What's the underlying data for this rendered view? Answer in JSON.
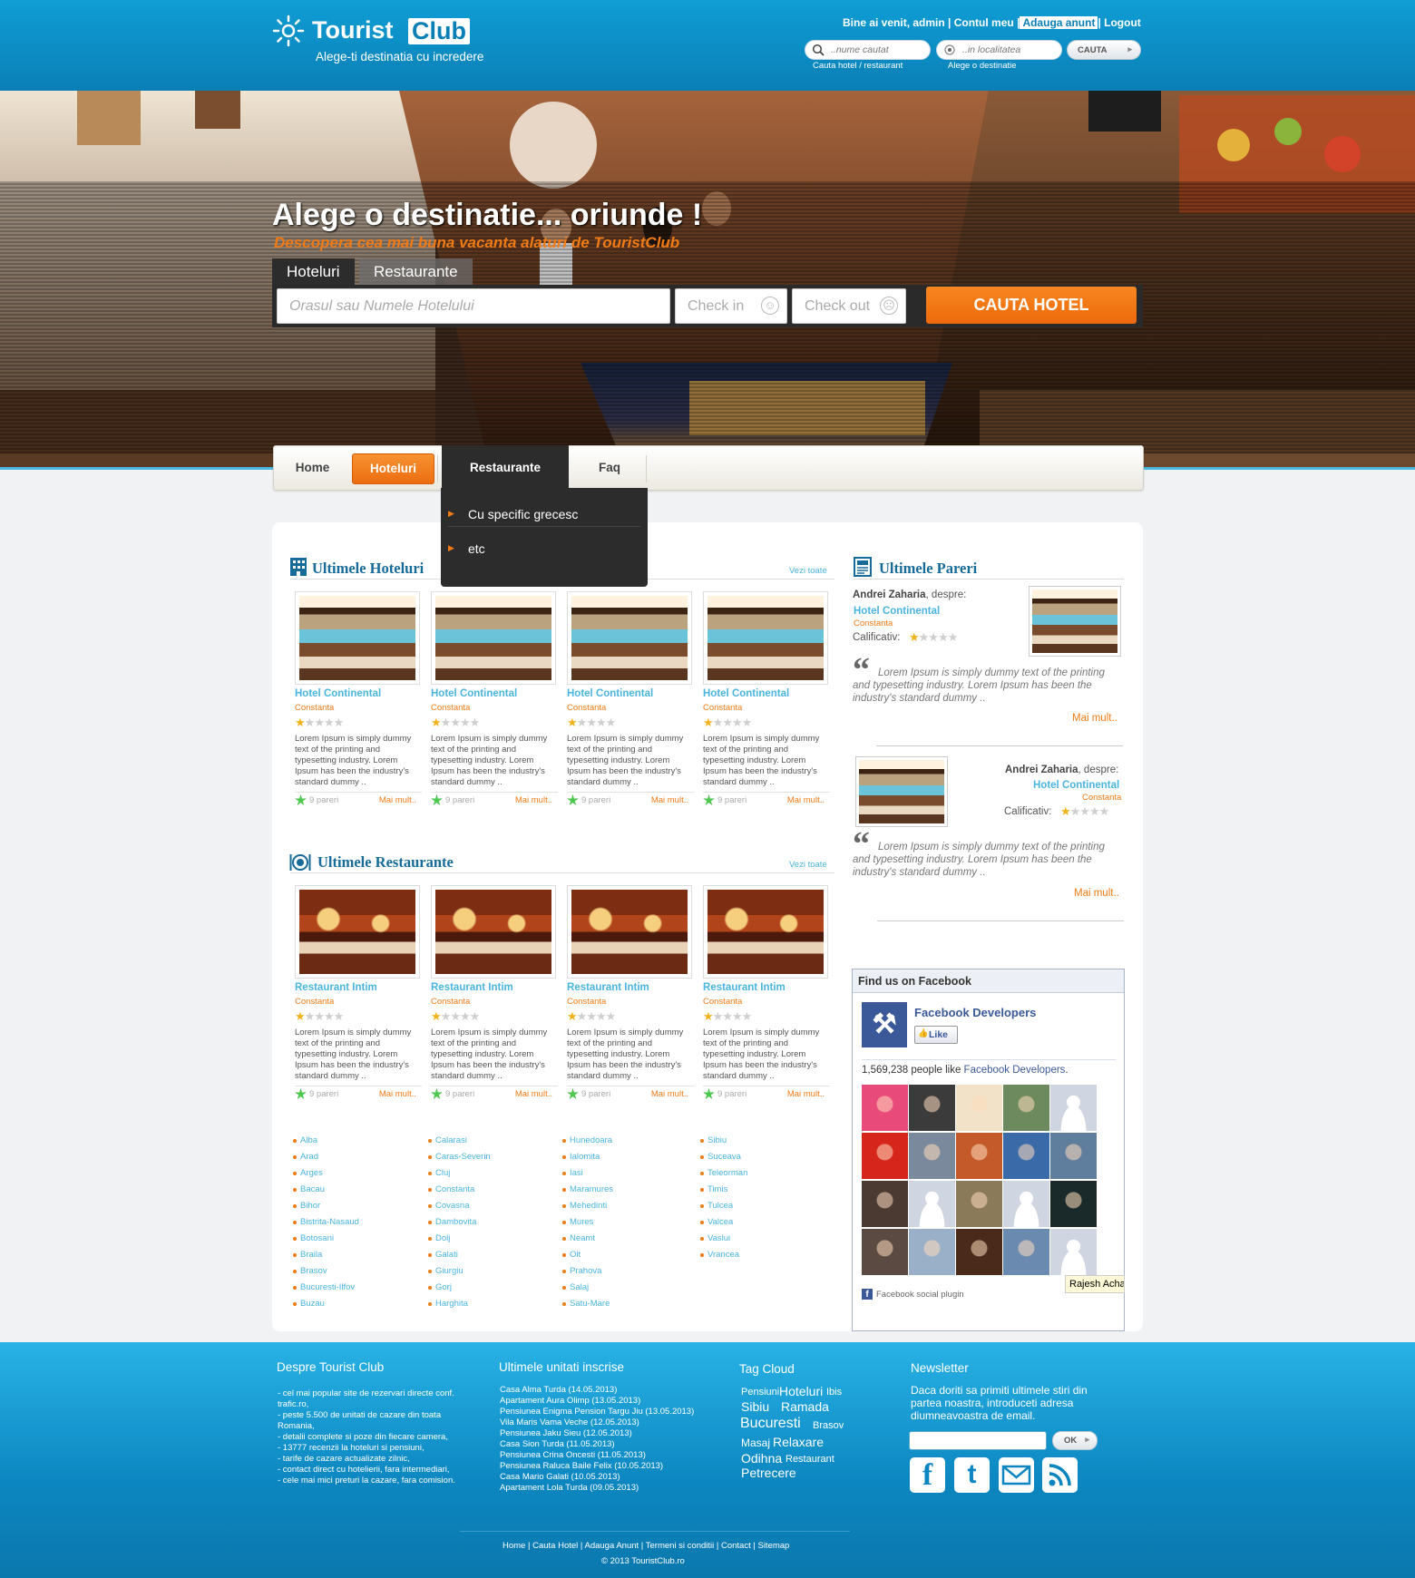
{
  "header": {
    "logo_word1": "Tourist",
    "logo_word2": "Club",
    "tagline": "Alege-ti destinatia cu incredere",
    "welcome": "Bine ai venit, admin",
    "my_account": "Contul meu",
    "add_listing": "Adauga anunt",
    "logout": "Logout",
    "name_placeholder": "..nume cautat",
    "location_placeholder": "..in localitatea",
    "search_button": "CAUTA",
    "name_caption": "Cauta hotel / restaurant",
    "location_caption": "Alege o destinatie"
  },
  "hero": {
    "title": "Alege o destinatie... oriunde !",
    "subtitle": "Descopera cea mai buna vacanta alaturi de TouristClub",
    "tabs": [
      "Hoteluri",
      "Restaurante"
    ],
    "search_placeholder": "Orasul sau Numele Hotelului",
    "checkin": "Check in",
    "checkout": "Check out",
    "search_button": "CAUTA HOTEL"
  },
  "nav": {
    "items": [
      "Home",
      "Hoteluri",
      "Restaurante",
      "Faq"
    ],
    "dropdown": [
      "Cu specific grecesc",
      "etc"
    ]
  },
  "hotels": {
    "title": "Ultimele Hoteluri",
    "see_all": "Vezi toate",
    "cards": [
      {
        "name": "Hotel Continental",
        "city": "Constanta",
        "rating": 1,
        "desc": "Lorem Ipsum is simply dummy text of the printing and typesetting industry. Lorem Ipsum has been the industry's standard dummy ..",
        "reviews": "9 pareri",
        "more": "Mai mult.."
      },
      {
        "name": "Hotel Continental",
        "city": "Constanta",
        "rating": 1,
        "desc": "Lorem Ipsum is simply dummy text of the printing and typesetting industry. Lorem Ipsum has been the industry's standard dummy ..",
        "reviews": "9 pareri",
        "more": "Mai mult.."
      },
      {
        "name": "Hotel Continental",
        "city": "Constanta",
        "rating": 1,
        "desc": "Lorem Ipsum is simply dummy text of the printing and typesetting industry. Lorem Ipsum has been the industry's standard dummy ..",
        "reviews": "9 pareri",
        "more": "Mai mult.."
      },
      {
        "name": "Hotel Continental",
        "city": "Constanta",
        "rating": 1,
        "desc": "Lorem Ipsum is simply dummy text of the printing and typesetting industry. Lorem Ipsum has been the industry's standard dummy ..",
        "reviews": "9 pareri",
        "more": "Mai mult.."
      }
    ]
  },
  "restaurants": {
    "title": "Ultimele Restaurante",
    "see_all": "Vezi toate",
    "cards": [
      {
        "name": "Restaurant Intim",
        "city": "Constanta",
        "rating": 1,
        "desc": "Lorem Ipsum is simply dummy text of the printing and typesetting industry. Lorem Ipsum has been the industry's standard dummy ..",
        "reviews": "9 pareri",
        "more": "Mai mult.."
      },
      {
        "name": "Restaurant Intim",
        "city": "Constanta",
        "rating": 1,
        "desc": "Lorem Ipsum is simply dummy text of the printing and typesetting industry. Lorem Ipsum has been the industry's standard dummy ..",
        "reviews": "9 pareri",
        "more": "Mai mult.."
      },
      {
        "name": "Restaurant Intim",
        "city": "Constanta",
        "rating": 1,
        "desc": "Lorem Ipsum is simply dummy text of the printing and typesetting industry. Lorem Ipsum has been the industry's standard dummy ..",
        "reviews": "9 pareri",
        "more": "Mai mult.."
      },
      {
        "name": "Restaurant Intim",
        "city": "Constanta",
        "rating": 1,
        "desc": "Lorem Ipsum is simply dummy text of the printing and typesetting industry. Lorem Ipsum has been the industry's standard dummy ..",
        "reviews": "9 pareri",
        "more": "Mai mult.."
      }
    ]
  },
  "regions": [
    [
      "Alba",
      "Arad",
      "Arges",
      "Bacau",
      "Bihor",
      "Bistrita-Nasaud",
      "Botosani",
      "Braila",
      "Brasov",
      "Bucuresti-Ilfov",
      "Buzau"
    ],
    [
      "Calarasi",
      "Caras-Severin",
      "Cluj",
      "Constanta",
      "Covasna",
      "Dambovita",
      "Dolj",
      "Galati",
      "Giurgiu",
      "Gorj",
      "Harghita"
    ],
    [
      "Hunedoara",
      "Ialomita",
      "Iasi",
      "Maramures",
      "Mehedinti",
      "Mures",
      "Neamt",
      "Olt",
      "Prahova",
      "Salaj",
      "Satu-Mare"
    ],
    [
      "Sibiu",
      "Suceava",
      "Teleorman",
      "Timis",
      "Tulcea",
      "Valcea",
      "Vaslui",
      "Vrancea"
    ]
  ],
  "reviews": {
    "title": "Ultimele Pareri",
    "items": [
      {
        "author": "Andrei Zaharia",
        "about": ", despre:",
        "hotel": "Hotel Continental",
        "city": "Constanta",
        "rating_label": "Calificativ:",
        "rating": 1,
        "quote": "Lorem Ipsum is simply dummy text of the printing and typesetting industry. Lorem Ipsum has been the industry's standard dummy ..",
        "more": "Mai mult.."
      },
      {
        "author": "Andrei Zaharia",
        "about": ", despre:",
        "hotel": "Hotel Continental",
        "city": "Constanta",
        "rating_label": "Calificativ:",
        "rating": 1,
        "quote": "Lorem Ipsum is simply dummy text of the printing and typesetting industry. Lorem Ipsum has been the industry's standard dummy ..",
        "more": "Mai mult.."
      }
    ]
  },
  "facebook": {
    "title": "Find us on Facebook",
    "page_name": "Facebook Developers",
    "like": "Like",
    "count_prefix": "1,569,238 people like",
    "count_page": "Facebook Developers",
    "count_suffix": ".",
    "tooltip": "Rajesh Acha",
    "plugin": "Facebook social plugin"
  },
  "footer": {
    "about_title": "Despre Tourist Club",
    "about_text": "- cel mai popular site de rezervari directe conf. trafic.ro,\n- peste 5.500 de unitati de cazare din toata Romania,\n- detalii complete si poze din fiecare camera,\n- 13777 recenzii la hoteluri si pensiuni,\n- tarife de cazare actualizate zilnic,\n- contact direct cu hotelierii, fara intermediari,\n- cele mai mici preturi la cazare, fara comision.",
    "latest_title": "Ultimele unitati inscrise",
    "latest": [
      "Casa Alma Turda (14.05.2013)",
      "Apartament Aura Olimp (13.05.2013)",
      "Pensiunea Enigma Pension Targu Jiu (13.05.2013)",
      "Vila Maris Vama Veche (12.05.2013)",
      "Pensiunea Jaku Sieu (12.05.2013)",
      "Casa Sion Turda (11.05.2013)",
      "Pensiunea Crina Oncesti (11.05.2013)",
      "Pensiunea Raluca Baile Felix (10.05.2013)",
      "Casa Mario Galati (10.05.2013)",
      "Apartament Lola Turda (09.05.2013)"
    ],
    "tags_title": "Tag Cloud",
    "tags": [
      "Pensiuni",
      "Hoteluri",
      "Ibis",
      "Sibiu",
      "Ramada",
      "Bucuresti",
      "Brasov",
      "Masaj",
      "Relaxare",
      "Odihna",
      "Restaurant",
      "Petrecere"
    ],
    "newsletter_title": "Newsletter",
    "newsletter_text": "Daca doriti sa primiti ultimele stiri din partea noastra, introduceti adresa diumneavoastra de email.",
    "newsletter_button": "OK",
    "links": "Home | Cauta Hotel | Adauga Anunt | Termeni si conditii | Contact | Sitemap",
    "copyright": "© 2013 TouristClub.ro"
  },
  "colors": {
    "accent_orange": "#f07b16",
    "link_blue": "#4ab5dd",
    "header_blue": "#0a7fb6",
    "title_blue": "#176b99"
  }
}
